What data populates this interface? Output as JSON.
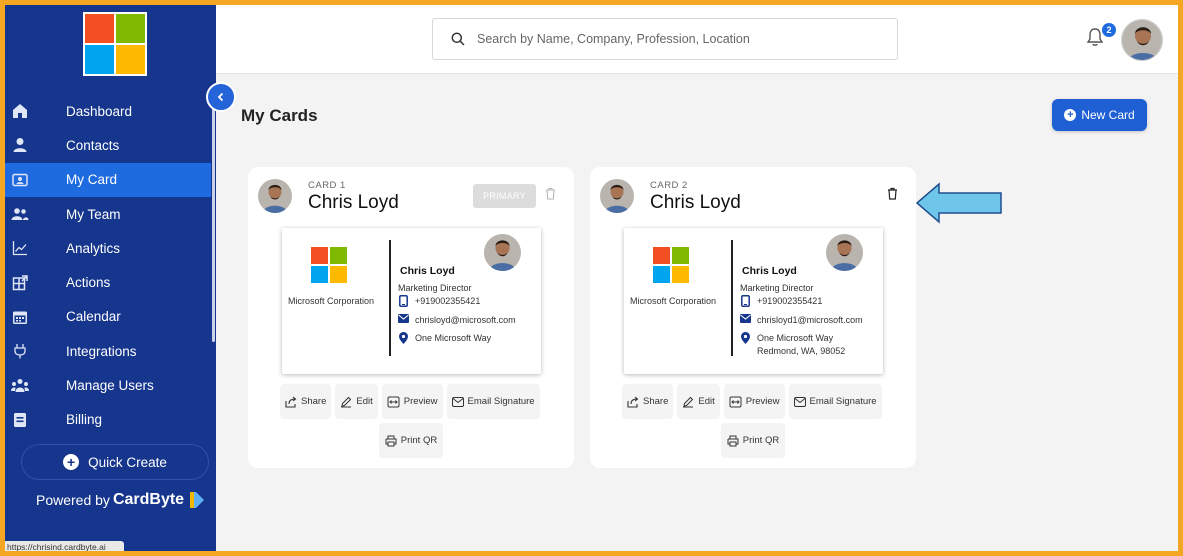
{
  "app": {
    "status_url": "https://chrisind.cardbyte.ai"
  },
  "sidebar": {
    "collapse_icon": "chevron-left-icon",
    "items": [
      {
        "label": "Dashboard",
        "icon": "home-icon",
        "active": false
      },
      {
        "label": "Contacts",
        "icon": "person-icon",
        "active": false
      },
      {
        "label": "My Card",
        "icon": "id-card-icon",
        "active": true
      },
      {
        "label": "My Team",
        "icon": "team-icon",
        "active": false
      },
      {
        "label": "Analytics",
        "icon": "chart-line-icon",
        "active": false
      },
      {
        "label": "Actions",
        "icon": "actions-icon",
        "active": false
      },
      {
        "label": "Calendar",
        "icon": "calendar-icon",
        "active": false
      },
      {
        "label": "Integrations",
        "icon": "plug-icon",
        "active": false
      },
      {
        "label": "Manage Users",
        "icon": "users-icon",
        "active": false
      },
      {
        "label": "Billing",
        "icon": "billing-icon",
        "active": false
      }
    ],
    "quick_create": "Quick Create",
    "powered_prefix": "Powered by",
    "powered_brand": "CardByte"
  },
  "header": {
    "search_placeholder": "Search by Name, Company, Profession, Location",
    "notification_count": "2"
  },
  "main": {
    "title": "My Cards",
    "new_card_label": "New Card"
  },
  "cards": [
    {
      "number_label": "CARD 1",
      "name": "Chris Loyd",
      "primary_label": "PRIMARY",
      "company": "Microsoft Corporation",
      "person_name": "Chris Loyd",
      "job_title": "Marketing Director",
      "phone": "+919002355421",
      "email": "chrisloyd@microsoft.com",
      "address_line1": "One Microsoft Way",
      "address_line2": "",
      "actions": {
        "share": "Share",
        "edit": "Edit",
        "preview": "Preview",
        "email_signature": "Email Signature",
        "print_qr": "Print QR"
      }
    },
    {
      "number_label": "CARD 2",
      "name": "Chris Loyd",
      "primary_label": "",
      "company": "Microsoft Corporation",
      "person_name": "Chris Loyd",
      "job_title": "Marketing Director",
      "phone": "+919002355421",
      "email": "chrisloyd1@microsoft.com",
      "address_line1": "One Microsoft Way",
      "address_line2": "Redmond, WA, 98052",
      "actions": {
        "share": "Share",
        "edit": "Edit",
        "preview": "Preview",
        "email_signature": "Email Signature",
        "print_qr": "Print QR"
      }
    }
  ],
  "colors": {
    "sidebar_bg": "#16358c",
    "active_item": "#1e6be0",
    "accent_button": "#1e5fd4",
    "frame_border": "#f5a623",
    "annotation_arrow": "#6ec6ea"
  }
}
